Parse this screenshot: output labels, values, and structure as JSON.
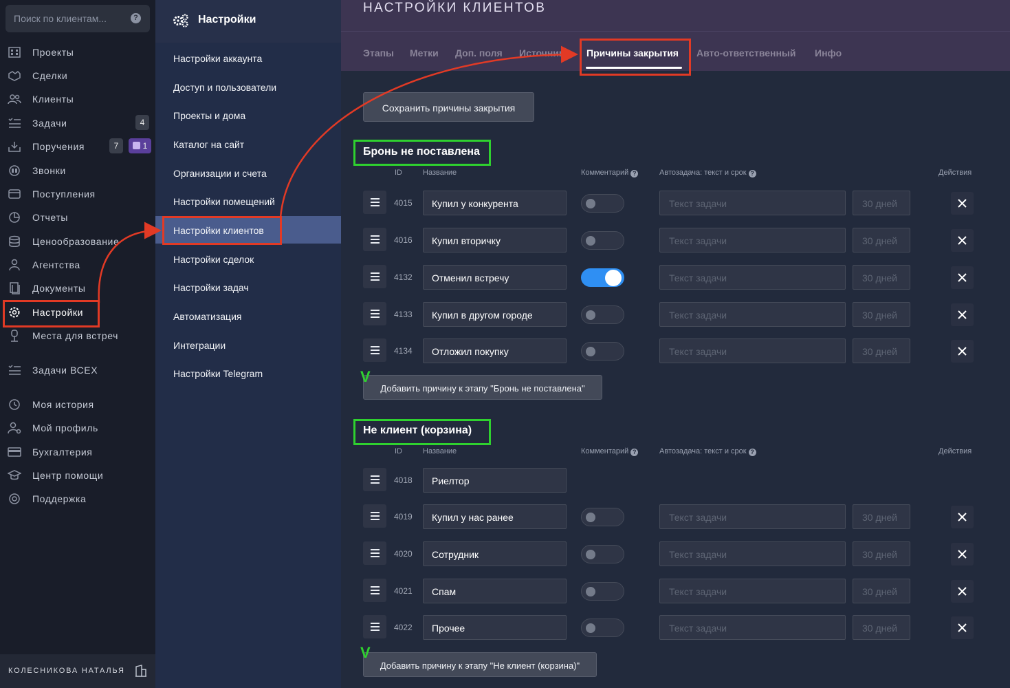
{
  "search": {
    "placeholder": "Поиск по клиентам..."
  },
  "nav": {
    "items": [
      {
        "label": "Проекты",
        "icon": "building-icon"
      },
      {
        "label": "Сделки",
        "icon": "handshake-icon"
      },
      {
        "label": "Клиенты",
        "icon": "users-icon"
      },
      {
        "label": "Задачи",
        "icon": "tasks-icon",
        "badge": "4"
      },
      {
        "label": "Поручения",
        "icon": "assignment-icon",
        "badge": "7",
        "badge2": "1"
      },
      {
        "label": "Звонки",
        "icon": "phone-icon"
      },
      {
        "label": "Поступления",
        "icon": "wallet-icon"
      },
      {
        "label": "Отчеты",
        "icon": "chart-icon"
      },
      {
        "label": "Ценообразование",
        "icon": "coins-icon"
      },
      {
        "label": "Агентства",
        "icon": "agent-icon"
      },
      {
        "label": "Документы",
        "icon": "documents-icon"
      },
      {
        "label": "Настройки",
        "icon": "gear-icon"
      },
      {
        "label": "Места для встреч",
        "icon": "place-icon"
      },
      {
        "label": "Задачи ВСЕХ",
        "icon": "tasks-all-icon"
      },
      {
        "label": "Моя история",
        "icon": "history-icon"
      },
      {
        "label": "Мой профиль",
        "icon": "profile-icon"
      },
      {
        "label": "Бухгалтерия",
        "icon": "accounting-icon"
      },
      {
        "label": "Центр помощи",
        "icon": "help-center-icon"
      },
      {
        "label": "Поддержка",
        "icon": "support-icon"
      }
    ],
    "user": "КОЛЕСНИКОВА НАТАЛЬЯ"
  },
  "settings_menu": {
    "title": "Настройки",
    "items": [
      "Настройки аккаунта",
      "Доступ и пользователи",
      "Проекты и дома",
      "Каталог на сайт",
      "Организации и счета",
      "Настройки помещений",
      "Настройки клиентов",
      "Настройки сделок",
      "Настройки задач",
      "Автоматизация",
      "Интеграции",
      "Настройки Telegram"
    ]
  },
  "main": {
    "title": "НАСТРОЙКИ КЛИЕНТОВ",
    "tabs": [
      "Этапы",
      "Метки",
      "Доп. поля",
      "Источники",
      "Причины закрытия",
      "Авто-ответственный",
      "Инфо"
    ],
    "save_button": "Сохранить причины закрытия",
    "columns": {
      "id": "ID",
      "name": "Название",
      "comment": "Комментарий",
      "autotask": "Автозадача: текст и срок",
      "actions": "Действия"
    },
    "task_placeholder": "Текст задачи",
    "days_placeholder": "30 дней",
    "sections": [
      {
        "title": "Бронь не поставлена",
        "add_button": "Добавить причину к этапу \"Бронь не поставлена\"",
        "rows": [
          {
            "id": "4015",
            "name": "Купил у конкурента",
            "comment_on": false
          },
          {
            "id": "4016",
            "name": "Купил вторичку",
            "comment_on": false
          },
          {
            "id": "4132",
            "name": "Отменил встречу",
            "comment_on": true
          },
          {
            "id": "4133",
            "name": "Купил в другом городе",
            "comment_on": false
          },
          {
            "id": "4134",
            "name": "Отложил покупку",
            "comment_on": false
          }
        ]
      },
      {
        "title": "Не клиент (корзина)",
        "add_button": "Добавить причину к этапу \"Не клиент (корзина)\"",
        "rows": [
          {
            "id": "4018",
            "name": "Риелтор",
            "comment_on": false,
            "fixed": true
          },
          {
            "id": "4019",
            "name": "Купил у нас ранее",
            "comment_on": false
          },
          {
            "id": "4020",
            "name": "Сотрудник",
            "comment_on": false
          },
          {
            "id": "4021",
            "name": "Спам",
            "comment_on": false
          },
          {
            "id": "4022",
            "name": "Прочее",
            "comment_on": false
          }
        ]
      }
    ]
  },
  "annotations": {
    "check_mark": "V"
  }
}
